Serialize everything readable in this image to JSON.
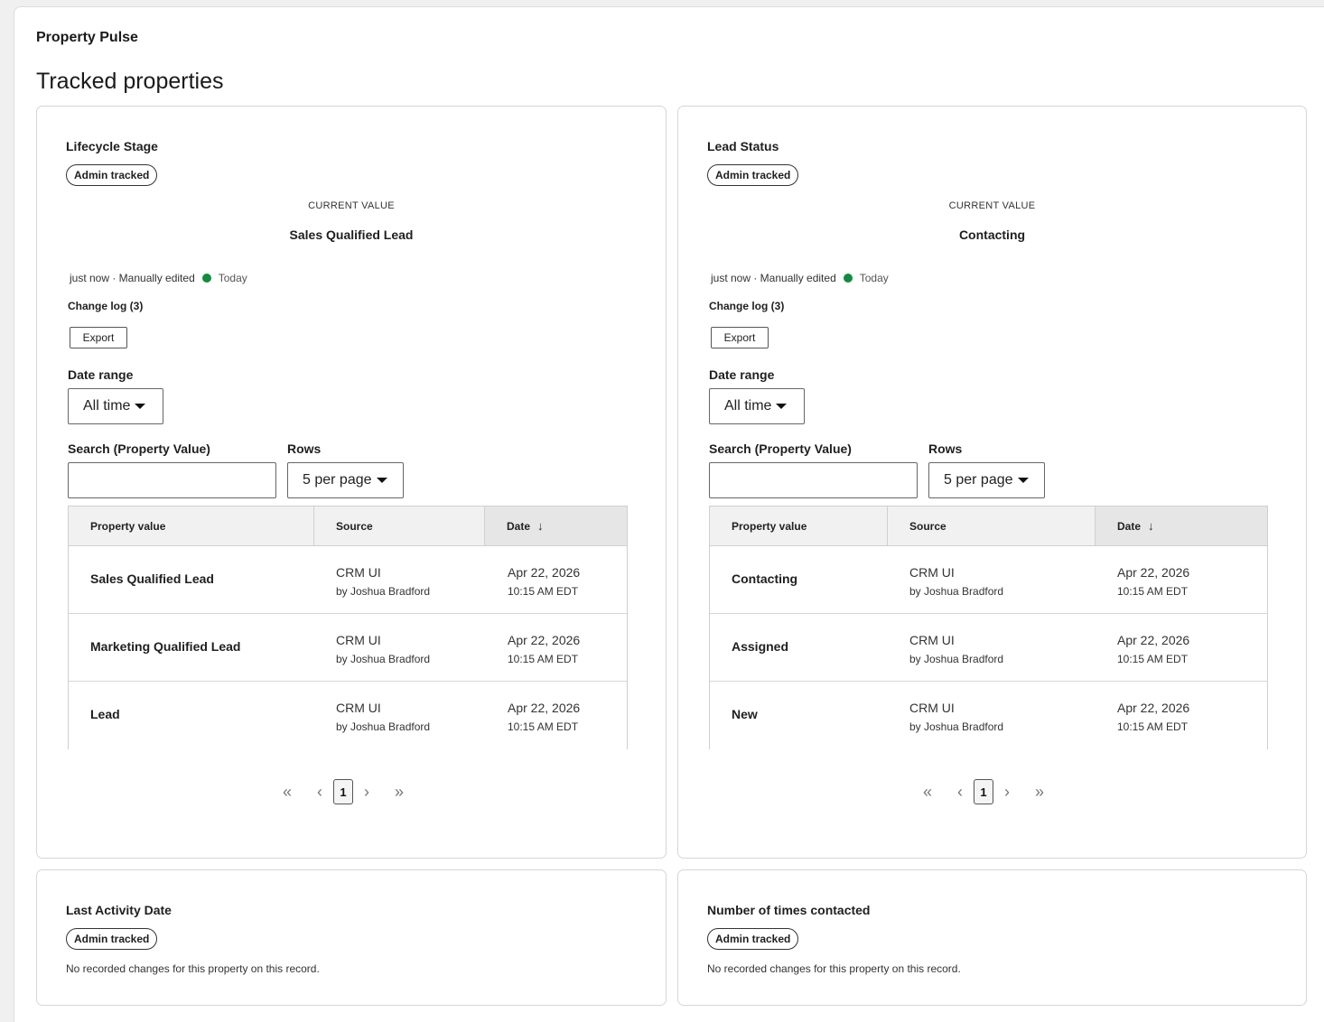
{
  "app": {
    "title": "Property Pulse"
  },
  "section": {
    "title": "Tracked properties"
  },
  "colors": {
    "status_dot": "#138a3e",
    "header_bg": "#f1f1f1"
  },
  "cards": [
    {
      "title": "Lifecycle Stage",
      "badge": "Admin tracked",
      "current_value_label": "CURRENT VALUE",
      "current_value": "Sales Qualified Lead",
      "meta_text": "just now · Manually edited",
      "meta_status": "Today",
      "change_log": "Change log (3)",
      "export": "Export",
      "date_range_label": "Date range",
      "date_range_value": "All time",
      "search_label": "Search (Property Value)",
      "search_value": "",
      "rows_label": "Rows",
      "rows_value": "5 per page",
      "columns": [
        "Property value",
        "Source",
        "Date"
      ],
      "sort_icon": "↓",
      "rows": [
        {
          "value": "Sales Qualified Lead",
          "source": "CRM UI",
          "by": "by Joshua Bradford",
          "date": "Apr 22, 2026",
          "time": "10:15 AM EDT"
        },
        {
          "value": "Marketing Qualified Lead",
          "source": "CRM UI",
          "by": "by Joshua Bradford",
          "date": "Apr 22, 2026",
          "time": "10:15 AM EDT"
        },
        {
          "value": "Lead",
          "source": "CRM UI",
          "by": "by Joshua Bradford",
          "date": "Apr 22, 2026",
          "time": "10:15 AM EDT"
        }
      ],
      "pager": {
        "first": "«",
        "prev": "‹",
        "page": "1",
        "next": "›",
        "last": "»"
      }
    },
    {
      "title": "Lead Status",
      "badge": "Admin tracked",
      "current_value_label": "CURRENT VALUE",
      "current_value": "Contacting",
      "meta_text": "just now · Manually edited",
      "meta_status": "Today",
      "change_log": "Change log (3)",
      "export": "Export",
      "date_range_label": "Date range",
      "date_range_value": "All time",
      "search_label": "Search (Property Value)",
      "search_value": "",
      "rows_label": "Rows",
      "rows_value": "5 per page",
      "columns": [
        "Property value",
        "Source",
        "Date"
      ],
      "sort_icon": "↓",
      "rows": [
        {
          "value": "Contacting",
          "source": "CRM UI",
          "by": "by Joshua Bradford",
          "date": "Apr 22, 2026",
          "time": "10:15 AM EDT"
        },
        {
          "value": "Assigned",
          "source": "CRM UI",
          "by": "by Joshua Bradford",
          "date": "Apr 22, 2026",
          "time": "10:15 AM EDT"
        },
        {
          "value": "New",
          "source": "CRM UI",
          "by": "by Joshua Bradford",
          "date": "Apr 22, 2026",
          "time": "10:15 AM EDT"
        }
      ],
      "pager": {
        "first": "«",
        "prev": "‹",
        "page": "1",
        "next": "›",
        "last": "»"
      }
    },
    {
      "title": "Last Activity Date",
      "badge": "Admin tracked",
      "empty_text": "No recorded changes for this property on this record."
    },
    {
      "title": "Number of times contacted",
      "badge": "Admin tracked",
      "empty_text": "No recorded changes for this property on this record."
    }
  ]
}
